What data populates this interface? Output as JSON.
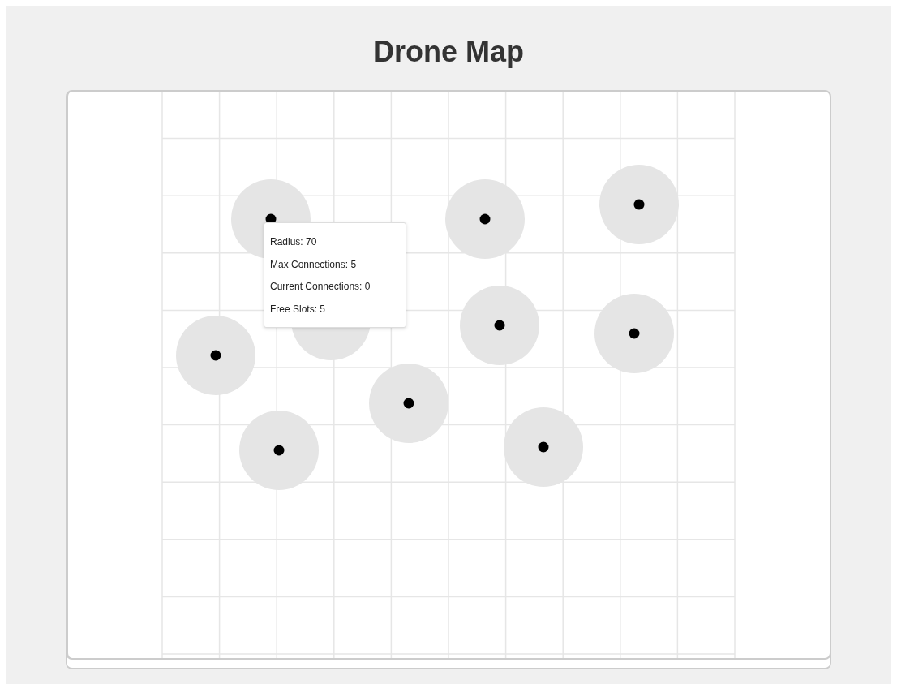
{
  "title": "Drone Map",
  "tooltip": {
    "lines": [
      "Radius: 70",
      "Max Connections: 5",
      "Current Connections: 0",
      "Free Slots: 5"
    ]
  }
}
